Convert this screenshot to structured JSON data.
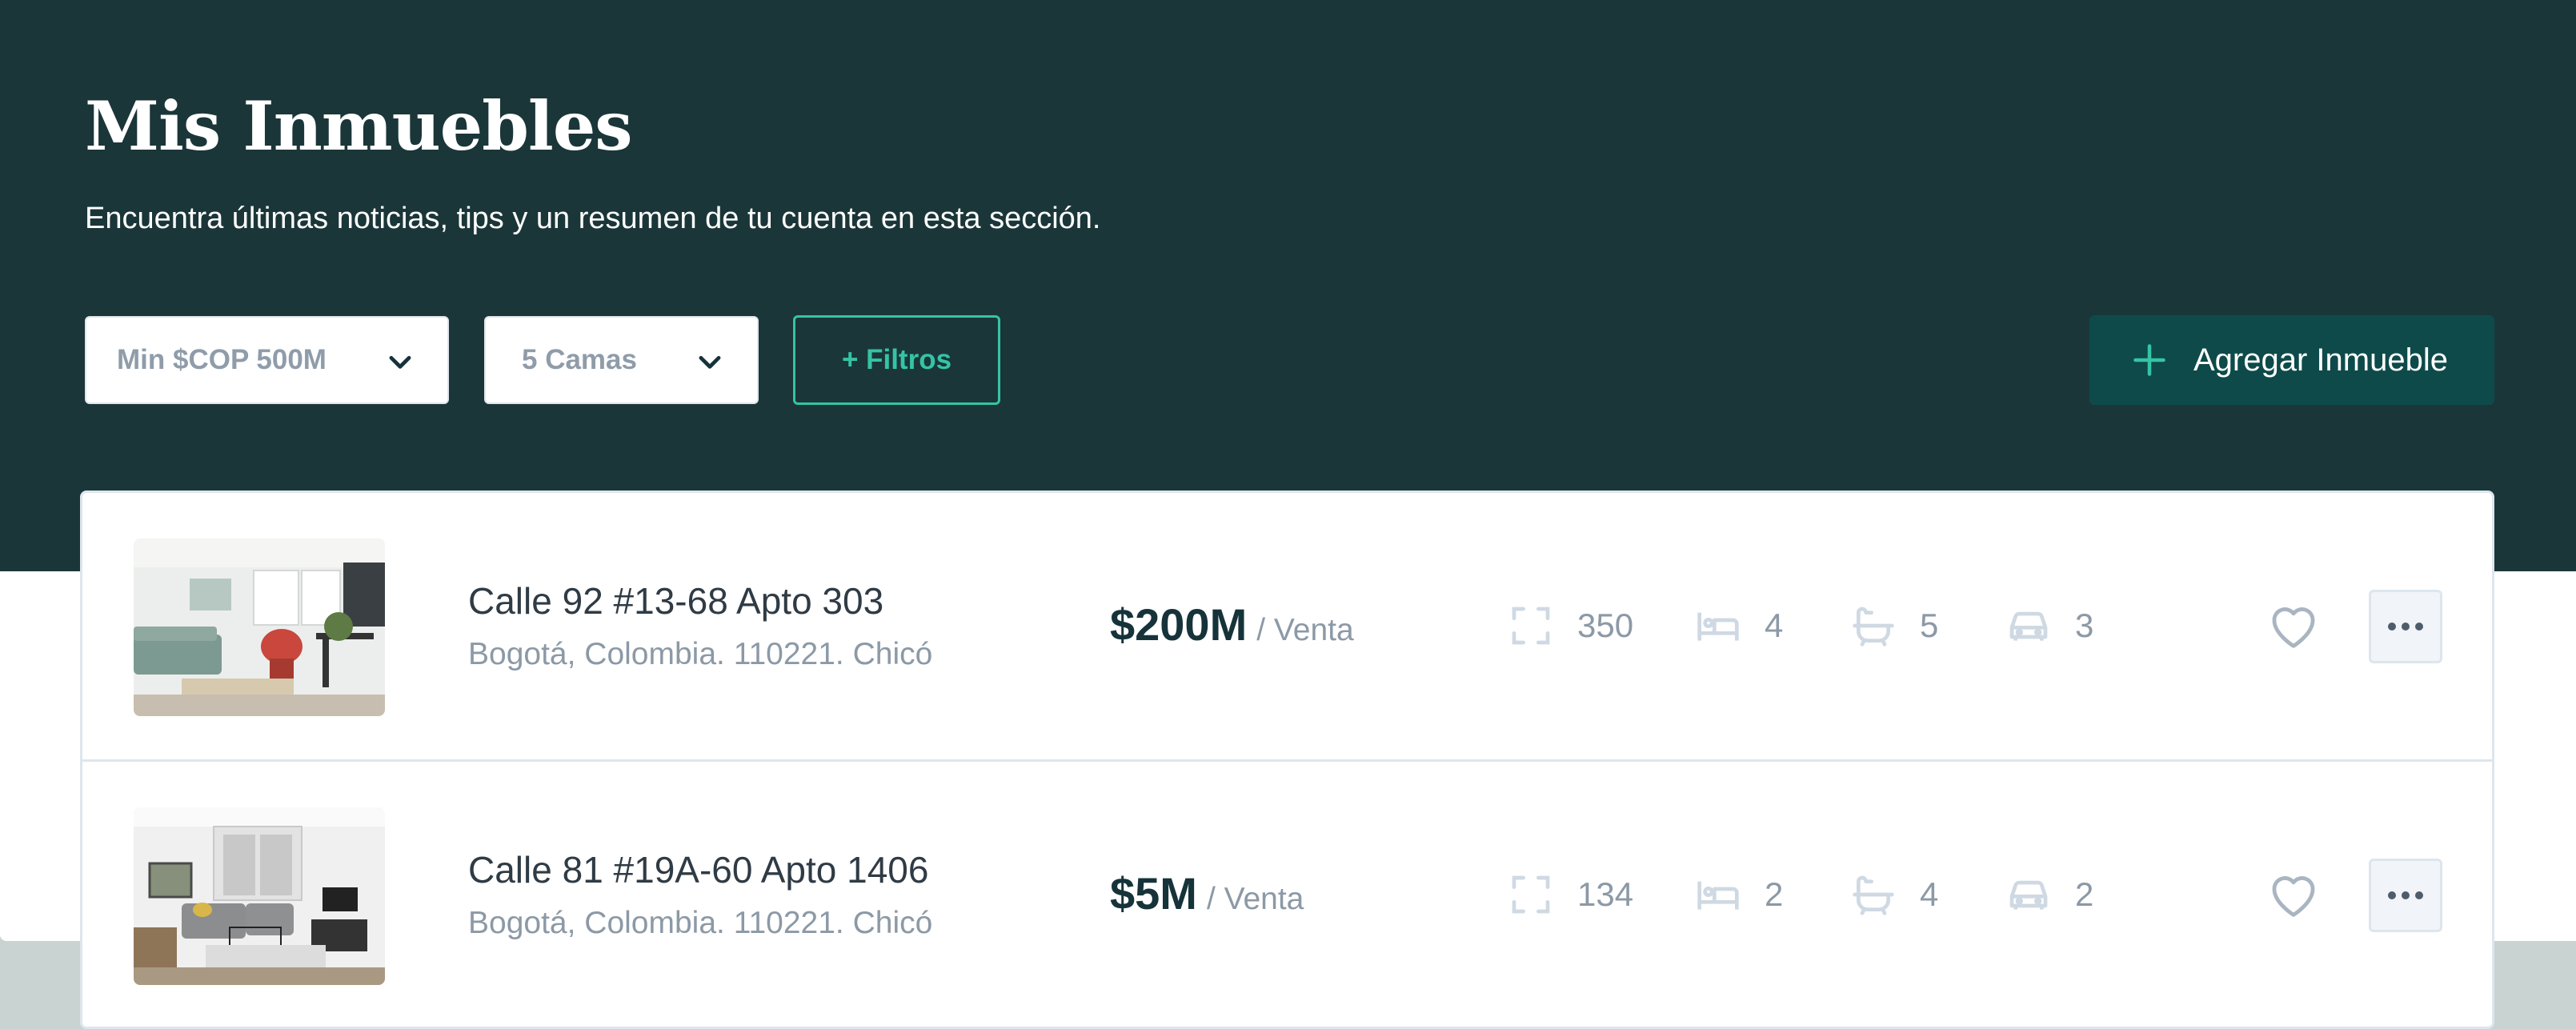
{
  "header": {
    "title": "Mis Inmuebles",
    "subtitle": "Encuentra últimas noticias, tips y un resumen de tu cuenta en esta sección."
  },
  "filters": {
    "price_select": "Min $COP 500M",
    "beds_select": "5 Camas",
    "more_filters_label": "+ Filtros"
  },
  "actions": {
    "add_property_label": "Agregar Inmueble"
  },
  "properties": [
    {
      "address": "Calle 92 #13-68 Apto 303",
      "location": "Bogotá, Colombia. 110221. Chicó",
      "price": "$200M",
      "price_type": "/ Venta",
      "area": "350",
      "beds": "4",
      "baths": "5",
      "parking": "3"
    },
    {
      "address": "Calle 81 #19A-60 Apto 1406",
      "location": "Bogotá, Colombia. 110221. Chicó",
      "price": "$5M",
      "price_type": "/ Venta",
      "area": "134",
      "beds": "2",
      "baths": "4",
      "parking": "2"
    }
  ],
  "icons": {
    "area": "area-icon",
    "beds": "bed-icon",
    "baths": "bathtub-icon",
    "parking": "car-icon",
    "favorite": "heart-icon",
    "more": "more-icon",
    "dropdown": "chevron-down-icon",
    "add": "plus-icon"
  },
  "colors": {
    "header_bg": "#1b3639",
    "accent": "#35c4a5",
    "primary_button": "#0e4a4a",
    "icon_muted": "#cfd9e3"
  }
}
